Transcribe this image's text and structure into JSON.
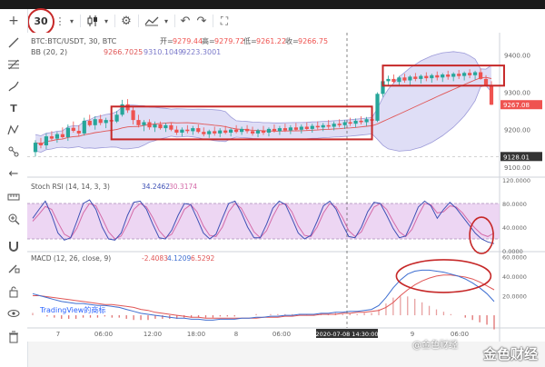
{
  "toolbar": {
    "interval": "30",
    "icons": [
      "more-vertical-icon",
      "candles-icon",
      "chevron-down-icon",
      "gear-icon",
      "indicators-icon",
      "undo-icon",
      "redo-icon",
      "fullscreen-icon"
    ]
  },
  "left_tools": [
    "crosshair-icon",
    "trendline-icon",
    "fib-icon",
    "brush-icon",
    "text-icon",
    "pattern-icon",
    "measure-icon",
    "arrow-left-icon",
    "ruler-icon",
    "zoom-icon",
    "magnet-icon",
    "lock-draw-icon",
    "lock-icon",
    "eye-icon",
    "trash-icon"
  ],
  "legend": {
    "symbol": "BTC:BTC/USDT, 30, BTC",
    "open_label": "开=",
    "open": "9279.44",
    "high_label": "高=",
    "high": "9279.72",
    "low_label": "低=",
    "low": "9261.22",
    "close_label": "收=",
    "close": "9266.75",
    "bb_label": "BB (20, 2)",
    "bb_values": [
      "9266.7025",
      "9310.1049",
      "9223.3001"
    ],
    "stoch_label": "Stoch RSI (14, 14, 3, 3)",
    "stoch_values": [
      "34.2462",
      "30.3174"
    ],
    "macd_label": "MACD (12, 26, close, 9)",
    "macd_values": [
      "-2.4083",
      "4.1209",
      "6.5292"
    ]
  },
  "price_axis": {
    "ticks": [
      "9400.00",
      "9300.00",
      "9200.00",
      "9100.00"
    ],
    "current_price": "9267.08",
    "crosshair_price": "9128.01"
  },
  "stoch_axis": {
    "ticks": [
      "120.0000",
      "80.0000",
      "40.0000",
      "0.0000"
    ]
  },
  "macd_axis": {
    "ticks": [
      "60.0000",
      "40.0000",
      "20.0000"
    ]
  },
  "time_axis": {
    "ticks": [
      "7",
      "06:00",
      "12:00",
      "18:00",
      "8",
      "06:00",
      "12:00",
      "9",
      "06:00"
    ],
    "crosshair_time": "2020-07-08 14:30:00"
  },
  "watermark": {
    "tv": "TradingView的商标",
    "brand": "金色财经",
    "tag": "@金色财经"
  },
  "colors": {
    "up": "#26a69a",
    "down": "#ef5350",
    "bb_fill": "#c5c3ef",
    "bb_line": "#9c9ad8",
    "basis": "#e05656",
    "stoch_k": "#3f51b5",
    "stoch_d": "#d46aa8",
    "stoch_band": "#e6c4ee",
    "macd": "#3f6fd1",
    "signal": "#e05656",
    "annot": "#c62828"
  },
  "chart_data": [
    {
      "type": "candlestick",
      "title": "BTC:BTC/USDT, 30, BTC",
      "ylim": [
        9080,
        9460
      ],
      "bars": [
        [
          9140,
          9172,
          9128,
          9165
        ],
        [
          9165,
          9178,
          9150,
          9158
        ],
        [
          9158,
          9190,
          9148,
          9182
        ],
        [
          9182,
          9196,
          9170,
          9176
        ],
        [
          9176,
          9194,
          9165,
          9188
        ],
        [
          9188,
          9206,
          9176,
          9180
        ],
        [
          9180,
          9214,
          9170,
          9205
        ],
        [
          9205,
          9222,
          9192,
          9197
        ],
        [
          9197,
          9212,
          9182,
          9190
        ],
        [
          9190,
          9232,
          9184,
          9224
        ],
        [
          9224,
          9240,
          9208,
          9212
        ],
        [
          9212,
          9236,
          9200,
          9228
        ],
        [
          9228,
          9240,
          9212,
          9218
        ],
        [
          9218,
          9232,
          9204,
          9226
        ],
        [
          9226,
          9242,
          9216,
          9222
        ],
        [
          9222,
          9250,
          9218,
          9240
        ],
        [
          9240,
          9280,
          9235,
          9268
        ],
        [
          9268,
          9282,
          9245,
          9252
        ],
        [
          9252,
          9262,
          9214,
          9226
        ],
        [
          9226,
          9240,
          9206,
          9212
        ],
        [
          9212,
          9226,
          9196,
          9220
        ],
        [
          9220,
          9228,
          9200,
          9206
        ],
        [
          9206,
          9222,
          9194,
          9214
        ],
        [
          9214,
          9222,
          9200,
          9204
        ],
        [
          9204,
          9218,
          9194,
          9212
        ],
        [
          9212,
          9220,
          9196,
          9200
        ],
        [
          9200,
          9210,
          9186,
          9192
        ],
        [
          9192,
          9206,
          9182,
          9200
        ],
        [
          9200,
          9212,
          9190,
          9196
        ],
        [
          9196,
          9210,
          9186,
          9204
        ],
        [
          9204,
          9214,
          9190,
          9194
        ],
        [
          9194,
          9206,
          9182,
          9188
        ],
        [
          9188,
          9200,
          9178,
          9196
        ],
        [
          9196,
          9208,
          9184,
          9190
        ],
        [
          9190,
          9204,
          9180,
          9198
        ],
        [
          9198,
          9210,
          9188,
          9192
        ],
        [
          9192,
          9204,
          9182,
          9200
        ],
        [
          9200,
          9212,
          9190,
          9194
        ],
        [
          9194,
          9208,
          9186,
          9202
        ],
        [
          9202,
          9212,
          9190,
          9196
        ],
        [
          9196,
          9208,
          9184,
          9190
        ],
        [
          9190,
          9202,
          9180,
          9198
        ],
        [
          9198,
          9210,
          9186,
          9192
        ],
        [
          9192,
          9206,
          9182,
          9202
        ],
        [
          9202,
          9214,
          9192,
          9196
        ],
        [
          9196,
          9210,
          9186,
          9204
        ],
        [
          9204,
          9216,
          9194,
          9198
        ],
        [
          9198,
          9212,
          9188,
          9206
        ],
        [
          9206,
          9218,
          9196,
          9200
        ],
        [
          9200,
          9214,
          9190,
          9208
        ],
        [
          9208,
          9220,
          9198,
          9202
        ],
        [
          9202,
          9216,
          9192,
          9210
        ],
        [
          9210,
          9222,
          9200,
          9206
        ],
        [
          9206,
          9218,
          9196,
          9212
        ],
        [
          9212,
          9226,
          9202,
          9208
        ],
        [
          9208,
          9222,
          9198,
          9216
        ],
        [
          9216,
          9228,
          9206,
          9212
        ],
        [
          9212,
          9226,
          9202,
          9220
        ],
        [
          9220,
          9232,
          9210,
          9216
        ],
        [
          9216,
          9230,
          9206,
          9224
        ],
        [
          9224,
          9236,
          9214,
          9220
        ],
        [
          9220,
          9234,
          9210,
          9228
        ],
        [
          9228,
          9240,
          9216,
          9224
        ],
        [
          9224,
          9300,
          9220,
          9296
        ],
        [
          9296,
          9340,
          9288,
          9330
        ],
        [
          9330,
          9345,
          9318,
          9336
        ],
        [
          9336,
          9348,
          9324,
          9328
        ],
        [
          9328,
          9344,
          9318,
          9340
        ],
        [
          9340,
          9350,
          9326,
          9332
        ],
        [
          9332,
          9346,
          9320,
          9342
        ],
        [
          9342,
          9352,
          9330,
          9336
        ],
        [
          9336,
          9348,
          9324,
          9344
        ],
        [
          9344,
          9354,
          9330,
          9338
        ],
        [
          9338,
          9350,
          9326,
          9346
        ],
        [
          9346,
          9356,
          9332,
          9340
        ],
        [
          9340,
          9352,
          9328,
          9348
        ],
        [
          9348,
          9358,
          9334,
          9342
        ],
        [
          9342,
          9354,
          9330,
          9350
        ],
        [
          9350,
          9360,
          9336,
          9344
        ],
        [
          9344,
          9356,
          9332,
          9352
        ],
        [
          9352,
          9362,
          9338,
          9346
        ],
        [
          9346,
          9358,
          9334,
          9354
        ],
        [
          9354,
          9364,
          9334,
          9336
        ],
        [
          9336,
          9346,
          9316,
          9320
        ],
        [
          9320,
          9330,
          9266,
          9267
        ]
      ]
    },
    {
      "type": "line",
      "title": "Stoch RSI (14, 14, 3, 3)",
      "ylim": [
        0,
        120
      ],
      "k": [
        55,
        70,
        84,
        60,
        30,
        18,
        22,
        50,
        80,
        86,
        70,
        40,
        20,
        18,
        30,
        60,
        82,
        84,
        70,
        45,
        22,
        20,
        35,
        60,
        80,
        78,
        55,
        30,
        20,
        28,
        55,
        80,
        84,
        65,
        40,
        22,
        22,
        45,
        72,
        84,
        78,
        55,
        30,
        20,
        26,
        50,
        76,
        84,
        70,
        45,
        24,
        22,
        40,
        66,
        82,
        80,
        60,
        38,
        22,
        25,
        48,
        74,
        84,
        76,
        55,
        70,
        82,
        72,
        58,
        44,
        30,
        20,
        15,
        12
      ],
      "d": [
        50,
        62,
        75,
        70,
        48,
        28,
        22,
        38,
        64,
        80,
        76,
        55,
        32,
        20,
        25,
        45,
        70,
        80,
        74,
        56,
        34,
        22,
        28,
        48,
        70,
        78,
        66,
        42,
        26,
        24,
        40,
        66,
        80,
        72,
        52,
        32,
        22,
        34,
        58,
        78,
        80,
        66,
        42,
        26,
        24,
        40,
        64,
        80,
        74,
        56,
        34,
        24,
        32,
        54,
        74,
        80,
        70,
        50,
        32,
        24,
        36,
        60,
        80,
        78,
        64,
        66,
        76,
        74,
        64,
        50,
        38,
        28,
        24,
        30
      ]
    },
    {
      "type": "line",
      "title": "MACD (12, 26, close, 9)",
      "ylim": [
        -12,
        64
      ],
      "macd": [
        22,
        20,
        18,
        16,
        14,
        13,
        12,
        12,
        11,
        10,
        10,
        9,
        8,
        6,
        4,
        2,
        1,
        0,
        -1,
        -2,
        -3,
        -3,
        -4,
        -4,
        -5,
        -5,
        -4,
        -4,
        -4,
        -3,
        -3,
        -2,
        -2,
        -1,
        -1,
        0,
        0,
        1,
        1,
        1,
        2,
        2,
        3,
        3,
        4,
        4,
        5,
        6,
        10,
        18,
        28,
        36,
        42,
        45,
        46,
        46,
        45,
        44,
        42,
        40,
        37,
        33,
        28,
        22,
        14
      ],
      "signal": [
        20,
        20,
        19,
        18,
        17,
        16,
        15,
        14,
        13,
        12,
        11,
        11,
        10,
        9,
        8,
        6,
        5,
        3,
        2,
        1,
        0,
        -1,
        -2,
        -2,
        -3,
        -3,
        -3,
        -3,
        -3,
        -3,
        -3,
        -3,
        -2,
        -2,
        -2,
        -1,
        -1,
        0,
        0,
        0,
        1,
        1,
        1,
        2,
        2,
        3,
        3,
        4,
        5,
        8,
        13,
        20,
        26,
        31,
        35,
        38,
        40,
        41,
        41,
        40,
        39,
        37,
        34,
        30,
        26
      ]
    }
  ]
}
